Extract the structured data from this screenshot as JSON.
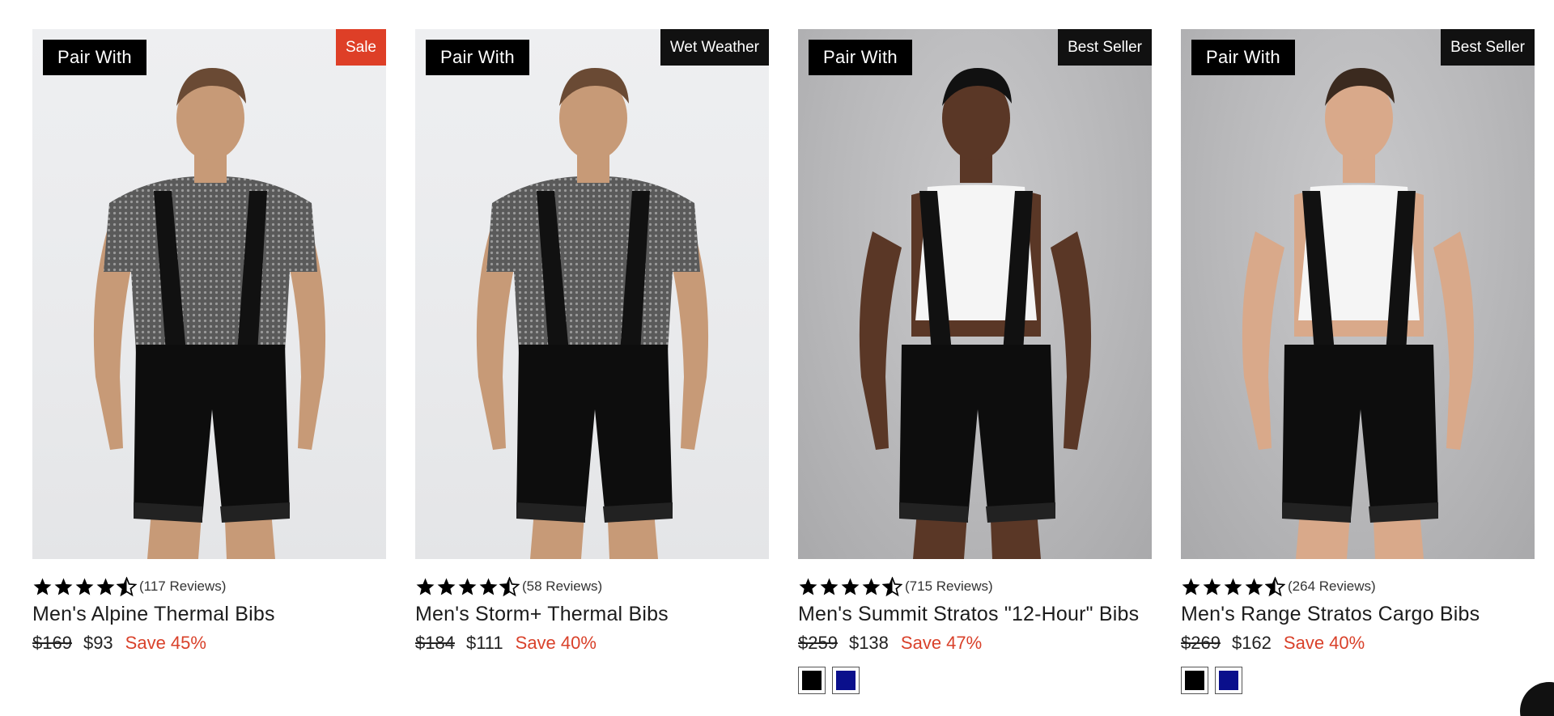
{
  "products": [
    {
      "pair_label": "Pair With",
      "badge": "Sale",
      "badge_style": "sale",
      "bg": "light",
      "shirt": "knit",
      "skin": "#c79a77",
      "hair": "#6a4a34",
      "rating": 4.5,
      "reviews": "(117 Reviews)",
      "title": "Men's Alpine Thermal Bibs",
      "price_old": "$169",
      "price_new": "$93",
      "save": "Save 45%",
      "swatches": []
    },
    {
      "pair_label": "Pair With",
      "badge": "Wet Weather",
      "badge_style": "dark",
      "bg": "light",
      "shirt": "knit",
      "skin": "#c79a77",
      "hair": "#6a4a34",
      "rating": 4.5,
      "reviews": "(58 Reviews)",
      "title": "Men's Storm+ Thermal Bibs",
      "price_old": "$184",
      "price_new": "$111",
      "save": "Save 40%",
      "swatches": []
    },
    {
      "pair_label": "Pair With",
      "badge": "Best Seller",
      "badge_style": "dark",
      "bg": "gray",
      "shirt": "white",
      "skin": "#5a3726",
      "hair": "#111111",
      "rating": 4.5,
      "reviews": "(715 Reviews)",
      "title": "Men's Summit Stratos \"12-Hour\" Bibs",
      "price_old": "$259",
      "price_new": "$138",
      "save": "Save 47%",
      "swatches": [
        {
          "name": "black-swatch",
          "color": "#000000"
        },
        {
          "name": "navy-swatch",
          "color": "#0a0f8c"
        }
      ]
    },
    {
      "pair_label": "Pair With",
      "badge": "Best Seller",
      "badge_style": "dark",
      "bg": "gray",
      "shirt": "white",
      "skin": "#d9a98a",
      "hair": "#3b2a1f",
      "rating": 4.5,
      "reviews": "(264 Reviews)",
      "title": "Men's Range Stratos Cargo Bibs",
      "price_old": "$269",
      "price_new": "$162",
      "save": "Save 40%",
      "swatches": [
        {
          "name": "black-swatch",
          "color": "#000000"
        },
        {
          "name": "navy-swatch",
          "color": "#0a0f8c"
        }
      ]
    }
  ]
}
